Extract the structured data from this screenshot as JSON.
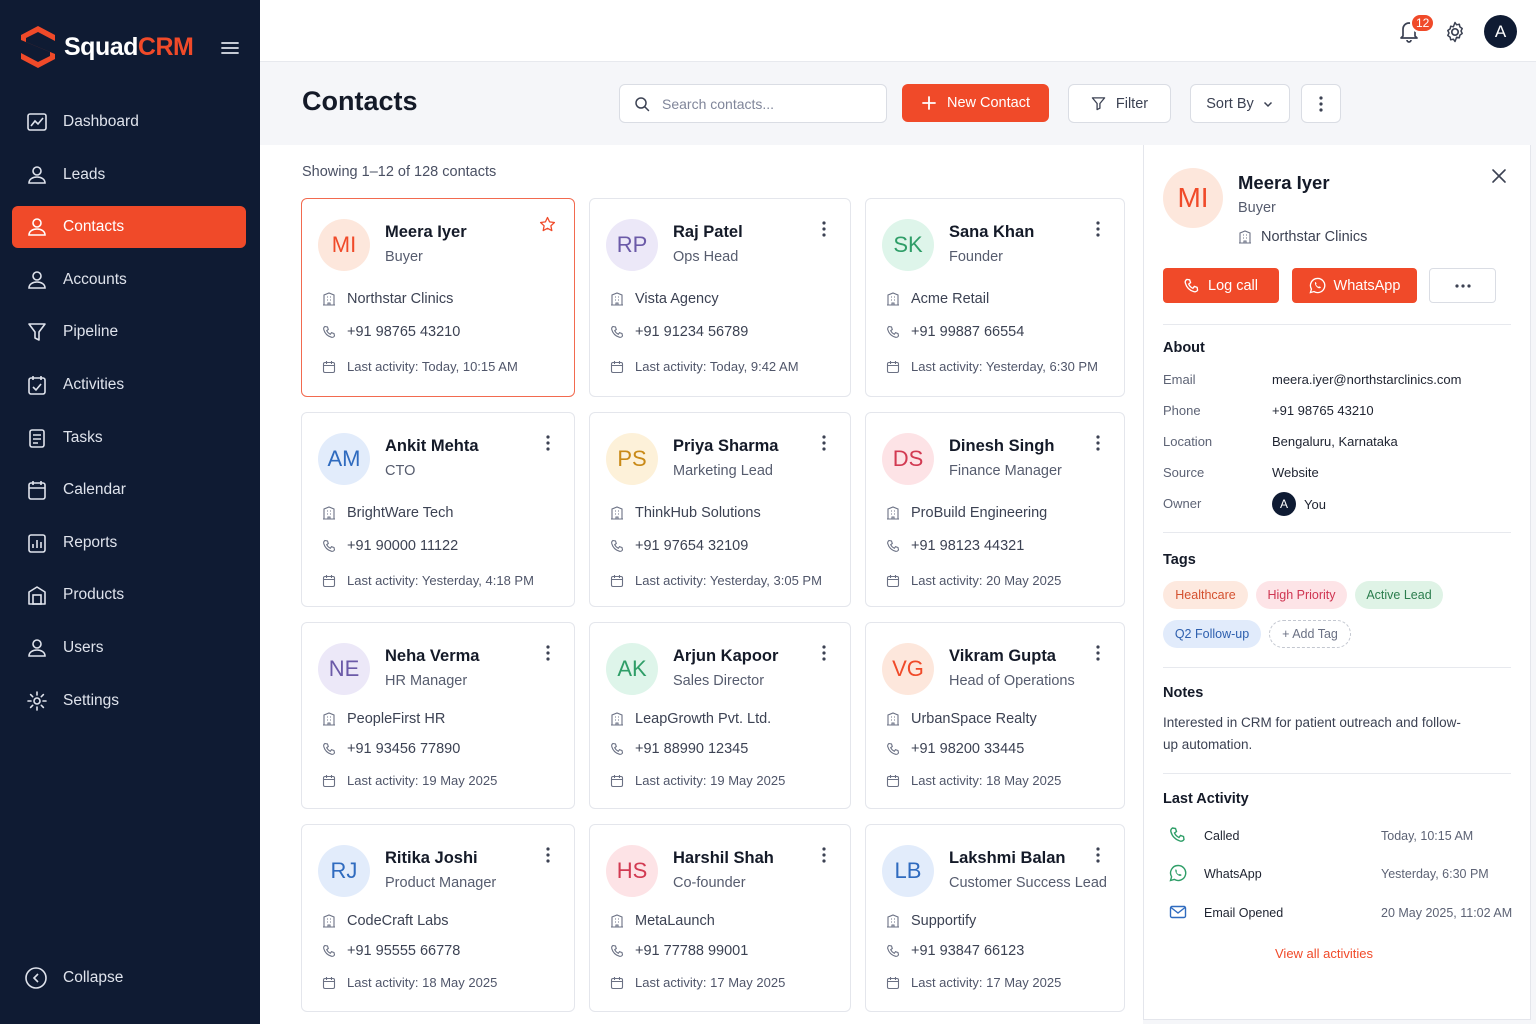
{
  "brand": {
    "name_part1": "Squad",
    "name_part2": "CRM"
  },
  "colors": {
    "accent": "#f04a29",
    "sidebar_bg": "#0f1b33"
  },
  "sidebar": {
    "items": [
      {
        "label": "Dashboard",
        "icon": "dashboard-icon"
      },
      {
        "label": "Leads",
        "icon": "leads-icon"
      },
      {
        "label": "Contacts",
        "icon": "contacts-icon",
        "active": true
      },
      {
        "label": "Accounts",
        "icon": "accounts-icon"
      },
      {
        "label": "Pipeline",
        "icon": "pipeline-icon"
      },
      {
        "label": "Activities",
        "icon": "activities-icon"
      },
      {
        "label": "Tasks",
        "icon": "tasks-icon"
      },
      {
        "label": "Calendar",
        "icon": "calendar-icon"
      },
      {
        "label": "Reports",
        "icon": "reports-icon"
      },
      {
        "label": "Products",
        "icon": "products-icon"
      },
      {
        "label": "Users",
        "icon": "users-icon"
      },
      {
        "label": "Settings",
        "icon": "settings-icon"
      }
    ],
    "collapse_label": "Collapse"
  },
  "topbar": {
    "notification_count": "12",
    "user_initial": "A"
  },
  "header": {
    "title": "Contacts",
    "search_placeholder": "Search contacts...",
    "new_contact_label": "New Contact",
    "filter_label": "Filter",
    "sort_label": "Sort By"
  },
  "list": {
    "showing": "Showing 1–12 of 128 contacts",
    "contacts": [
      {
        "initials": "MI",
        "name": "Meera Iyer",
        "role": "Buyer",
        "company": "Northstar Clinics",
        "phone": "+91 98765 43210",
        "activity": "Last activity: Today, 10:15 AM",
        "avatar_bg": "#fde7dc",
        "avatar_fg": "#f04a29",
        "selected": true
      },
      {
        "initials": "RP",
        "name": "Raj Patel",
        "role": "Ops Head",
        "company": "Vista Agency",
        "phone": "+91 91234 56789",
        "activity": "Last activity: Today, 9:42 AM",
        "avatar_bg": "#ece8f8",
        "avatar_fg": "#6b5aa8"
      },
      {
        "initials": "SK",
        "name": "Sana Khan",
        "role": "Founder",
        "company": "Acme Retail",
        "phone": "+91 99887 66554",
        "activity": "Last activity: Yesterday, 6:30 PM",
        "avatar_bg": "#def5ea",
        "avatar_fg": "#2f9e68"
      },
      {
        "initials": "AM",
        "name": "Ankit Mehta",
        "role": "CTO",
        "company": "BrightWare Tech",
        "phone": "+91 90000 11122",
        "activity": "Last activity: Yesterday, 4:18 PM",
        "avatar_bg": "#e2ecfb",
        "avatar_fg": "#2f6bbf"
      },
      {
        "initials": "PS",
        "name": "Priya Sharma",
        "role": "Marketing Lead",
        "company": "ThinkHub Solutions",
        "phone": "+91 97654 32109",
        "activity": "Last activity: Yesterday, 3:05 PM",
        "avatar_bg": "#fdf1d9",
        "avatar_fg": "#c98a18"
      },
      {
        "initials": "DS",
        "name": "Dinesh Singh",
        "role": "Finance Manager",
        "company": "ProBuild Engineering",
        "phone": "+91 98123 44321",
        "activity": "Last activity: 20 May 2025",
        "avatar_bg": "#fde3e6",
        "avatar_fg": "#d23a52"
      },
      {
        "initials": "NE",
        "name": "Neha Verma",
        "role": "HR Manager",
        "company": "PeopleFirst HR",
        "phone": "+91 93456 77890",
        "activity": "Last activity: 19 May 2025",
        "avatar_bg": "#ece8f8",
        "avatar_fg": "#6b5aa8"
      },
      {
        "initials": "AK",
        "name": "Arjun Kapoor",
        "role": "Sales Director",
        "company": "LeapGrowth Pvt. Ltd.",
        "phone": "+91 88990 12345",
        "activity": "Last activity: 19 May 2025",
        "avatar_bg": "#def5ea",
        "avatar_fg": "#2f9e68"
      },
      {
        "initials": "VG",
        "name": "Vikram Gupta",
        "role": "Head of Operations",
        "company": "UrbanSpace Realty",
        "phone": "+91 98200 33445",
        "activity": "Last activity: 18 May 2025",
        "avatar_bg": "#fde7dc",
        "avatar_fg": "#f04a29"
      },
      {
        "initials": "RJ",
        "name": "Ritika Joshi",
        "role": "Product Manager",
        "company": "CodeCraft Labs",
        "phone": "+91 95555 66778",
        "activity": "Last activity: 18 May 2025",
        "avatar_bg": "#e2ecfb",
        "avatar_fg": "#2f6bbf"
      },
      {
        "initials": "HS",
        "name": "Harshil Shah",
        "role": "Co-founder",
        "company": "MetaLaunch",
        "phone": "+91 77788 99001",
        "activity": "Last activity: 17 May 2025",
        "avatar_bg": "#fde3e6",
        "avatar_fg": "#d23a52"
      },
      {
        "initials": "LB",
        "name": "Lakshmi Balan",
        "role": "Customer Success Lead",
        "company": "Supportify",
        "phone": "+91 93847 66123",
        "activity": "Last activity: 17 May 2025",
        "avatar_bg": "#e2ecfb",
        "avatar_fg": "#2f6bbf"
      }
    ]
  },
  "detail": {
    "initials": "MI",
    "name": "Meera Iyer",
    "role": "Buyer",
    "company": "Northstar Clinics",
    "log_call_label": "Log call",
    "whatsapp_label": "WhatsApp",
    "about_title": "About",
    "about": [
      {
        "key": "Email",
        "value": "meera.iyer@northstarclinics.com"
      },
      {
        "key": "Phone",
        "value": "+91 98765 43210"
      },
      {
        "key": "Location",
        "value": "Bengaluru, Karnataka"
      },
      {
        "key": "Source",
        "value": "Website"
      },
      {
        "key": "Owner",
        "value": "You",
        "owner_initial": "A"
      }
    ],
    "tags_title": "Tags",
    "tags": [
      {
        "label": "Healthcare",
        "bg": "#fde9df",
        "fg": "#d4502e"
      },
      {
        "label": "High Priority",
        "bg": "#fde4e7",
        "fg": "#cf3451"
      },
      {
        "label": "Active Lead",
        "bg": "#dff3e6",
        "fg": "#2b7d4d"
      },
      {
        "label": "Q2 Follow-up",
        "bg": "#e1ebfb",
        "fg": "#2d5fae"
      }
    ],
    "add_tag_label": "+ Add Tag",
    "notes_title": "Notes",
    "notes": "Interested in CRM for patient outreach and follow-up automation.",
    "activity_title": "Last Activity",
    "activities": [
      {
        "label": "Called",
        "time": "Today, 10:15 AM",
        "icon": "phone-icon"
      },
      {
        "label": "WhatsApp",
        "time": "Yesterday, 6:30 PM",
        "icon": "whatsapp-icon"
      },
      {
        "label": "Email Opened",
        "time": "20 May 2025, 11:02 AM",
        "icon": "mail-icon"
      }
    ],
    "view_all_label": "View all activities"
  }
}
